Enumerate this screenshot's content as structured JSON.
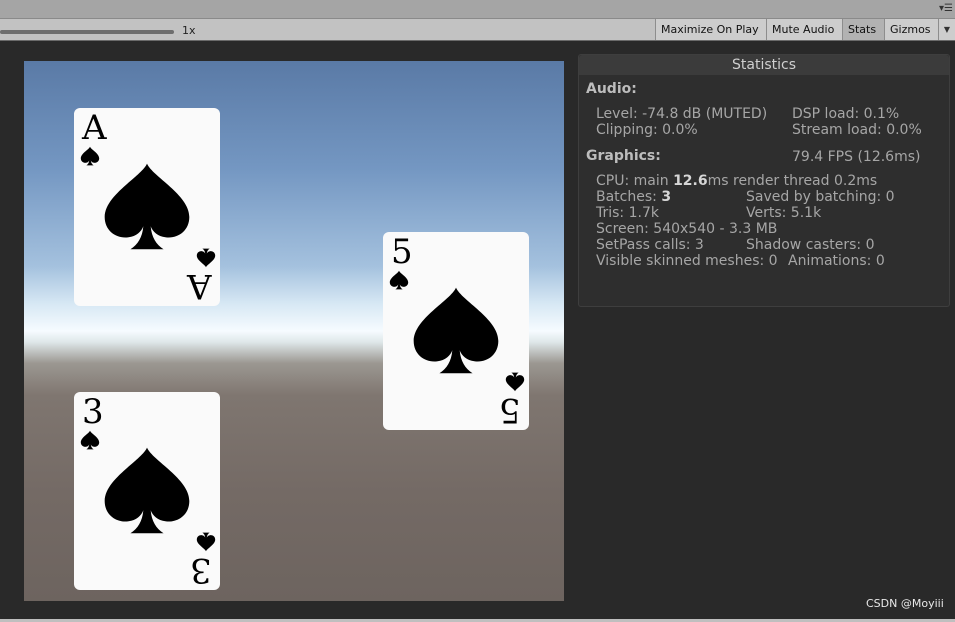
{
  "toolbar": {
    "scale_label": "1x",
    "maximize_on_play": "Maximize On Play",
    "mute_audio": "Mute Audio",
    "stats": "Stats",
    "gizmos": "Gizmos"
  },
  "game_view": {
    "cards": [
      {
        "rank": "A",
        "suit": "spade"
      },
      {
        "rank": "5",
        "suit": "spade"
      },
      {
        "rank": "3",
        "suit": "spade"
      }
    ]
  },
  "statistics": {
    "title": "Statistics",
    "audio": {
      "heading": "Audio:",
      "level": "Level: -74.8 dB (MUTED)",
      "dsp_load": "DSP load: 0.1%",
      "clipping": "Clipping: 0.0%",
      "stream_load": "Stream load: 0.0%"
    },
    "graphics": {
      "heading": "Graphics:",
      "fps": "79.4 FPS (12.6ms)",
      "cpu_prefix": "CPU: main ",
      "cpu_main": "12.6",
      "cpu_suffix": "ms  render thread 0.2ms",
      "batches_prefix": "Batches: ",
      "batches": "3",
      "saved_by_batching": "Saved by batching: 0",
      "tris": "Tris: 1.7k",
      "verts": "Verts: 5.1k",
      "screen": "Screen: 540x540 - 3.3 MB",
      "setpass": "SetPass calls: 3",
      "shadow_casters": "Shadow casters: 0",
      "visible_skinned": "Visible skinned meshes: 0",
      "animations": "Animations: 0"
    }
  },
  "watermark": "CSDN @Moyiii",
  "colors": {
    "editor_bg": "#292929",
    "toolbar_bg": "#c2c2c2",
    "stats_panel": "#2e2e2e",
    "card_face": "#fafafa"
  },
  "icons": [
    "menu-icon",
    "spade-icon",
    "dropdown-arrow-icon"
  ]
}
